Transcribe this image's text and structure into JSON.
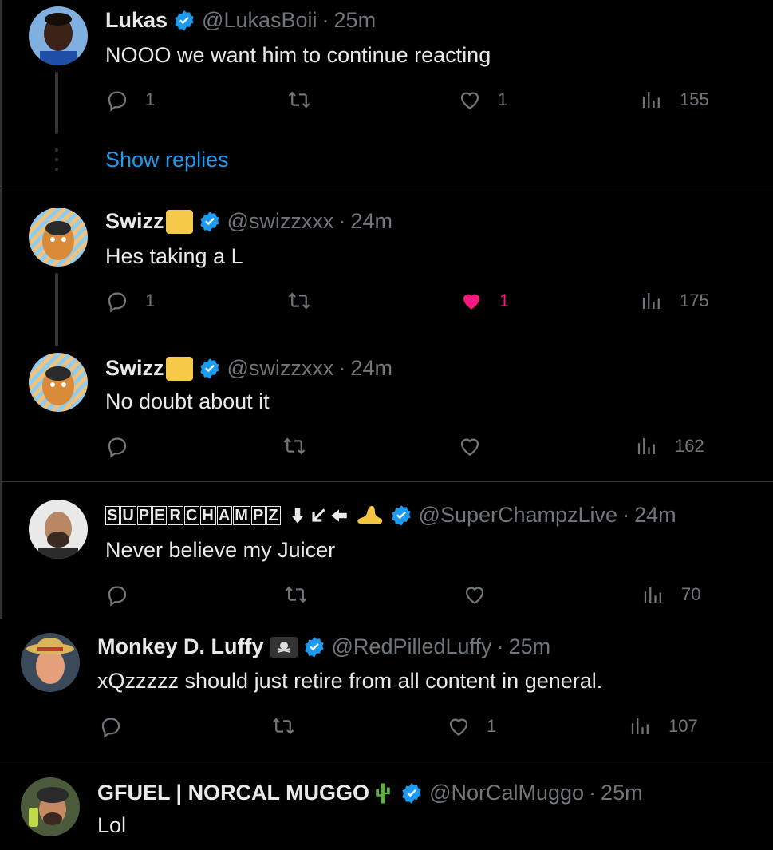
{
  "tweets": [
    {
      "name": "Lukas",
      "handle": "@LukasBoii",
      "time": "25m",
      "text": "NOOO we want him to continue reacting",
      "replies": "1",
      "likes": "1",
      "views": "155",
      "show_replies": "Show replies"
    },
    {
      "name": "Swizz",
      "handle": "@swizzxxx",
      "time": "24m",
      "text": "Hes taking a L",
      "replies": "1",
      "likes": "1",
      "views": "175",
      "liked": true
    },
    {
      "name": "Swizz",
      "handle": "@swizzxxx",
      "time": "24m",
      "text": "No doubt about it",
      "views": "162"
    },
    {
      "name": "SUPERCHAMPZ",
      "handle": "@SuperChampzLive",
      "time": "24m",
      "text": "Never believe my Juicer",
      "views": "70"
    },
    {
      "name": "Monkey D. Luffy",
      "handle": "@RedPilledLuffy",
      "time": "25m",
      "text": "xQzzzzz should just retire from all content in general.",
      "likes": "1",
      "views": "107"
    },
    {
      "name": "GFUEL | NORCAL MUGGO",
      "handle": "@NorCalMuggo",
      "time": "25m",
      "text": "Lol"
    }
  ],
  "separator": "·",
  "colors": {
    "background": "#000000",
    "verified": "#1d9bf0",
    "like_active": "#f91880",
    "muted": "#71767b",
    "text": "#e7e9ea"
  },
  "icons": [
    "reply-icon",
    "retweet-icon",
    "like-icon",
    "views-icon",
    "verified-badge-icon"
  ]
}
